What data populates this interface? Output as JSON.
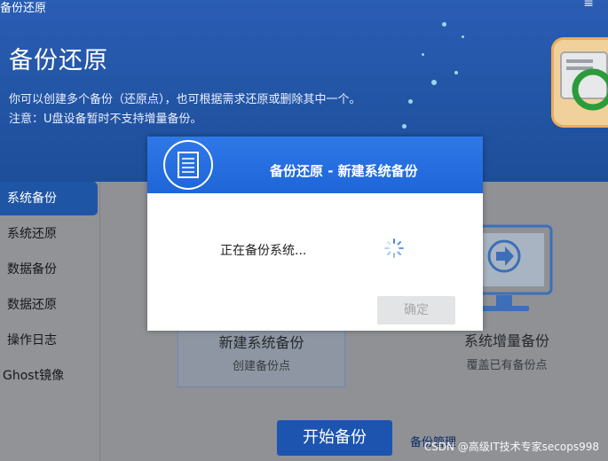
{
  "window": {
    "title": "备份还原"
  },
  "header": {
    "title": "备份还原",
    "description": "你可以创建多个备份（还原点），也可根据需求还原或删除其中一个。",
    "note": "注意：U盘设备暂时不支持增量备份。"
  },
  "sidebar": {
    "items": [
      {
        "label": "系统备份",
        "active": true
      },
      {
        "label": "系统还原"
      },
      {
        "label": "数据备份"
      },
      {
        "label": "数据还原"
      },
      {
        "label": "操作日志"
      },
      {
        "label": "Ghost镜像"
      }
    ]
  },
  "main": {
    "options": [
      {
        "title": "新建系统备份",
        "subtitle": "创建备份点",
        "selected": true
      },
      {
        "title": "系统增量备份",
        "subtitle": "覆盖已有备份点"
      }
    ],
    "start_button": "开始备份",
    "manage_link": "备份管理"
  },
  "dialog": {
    "title": "备份还原 - 新建系统备份",
    "status_text": "正在备份系统...",
    "ok_button": "确定",
    "ok_enabled": false
  },
  "watermark": "CSDN @高级IT技术专家secops998",
  "icons": {
    "menu": "hamburger-menu-icon",
    "document": "document-icon",
    "spinner": "loading-spinner-icon",
    "monitor": "monitor-arrow-icon",
    "logo": "backup-restore-logo"
  },
  "colors": {
    "header_blue": "#1f4f9d",
    "dialog_header": "#2a73e3",
    "active_item": "#1f55a5",
    "start_button": "#1d54b0"
  }
}
